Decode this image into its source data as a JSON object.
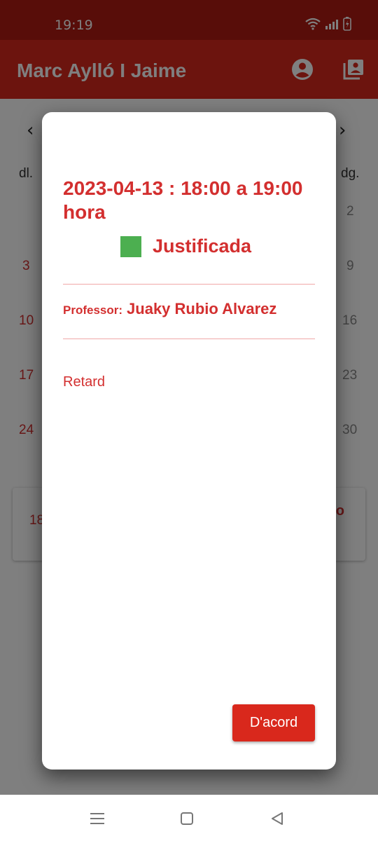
{
  "status_bar": {
    "time": "19:19"
  },
  "app_bar": {
    "title": "Marc Aylló I Jaime"
  },
  "calendar": {
    "prev_arrow": "‹",
    "next_arrow": "›",
    "weekday_first": "dl.",
    "weekday_last": "dg.",
    "left_days": [
      "3",
      "10",
      "17",
      "24"
    ],
    "right_days": [
      "2",
      "9",
      "16",
      "23",
      "30"
    ],
    "card_left_text": "18",
    "card_right_text": "o"
  },
  "dialog": {
    "datetime": "2023-04-13 : 18:00 a 19:00 hora",
    "status_label": "Justificada",
    "status_color": "#4caf50",
    "professor_label": "Professor:",
    "professor_name": "Juaky Rubio Alvarez",
    "note": "Retard",
    "ok_label": "D'acord"
  },
  "colors": {
    "primary": "#d9281c",
    "status_bar": "#b01a12",
    "accent_text": "#d32f2f"
  }
}
